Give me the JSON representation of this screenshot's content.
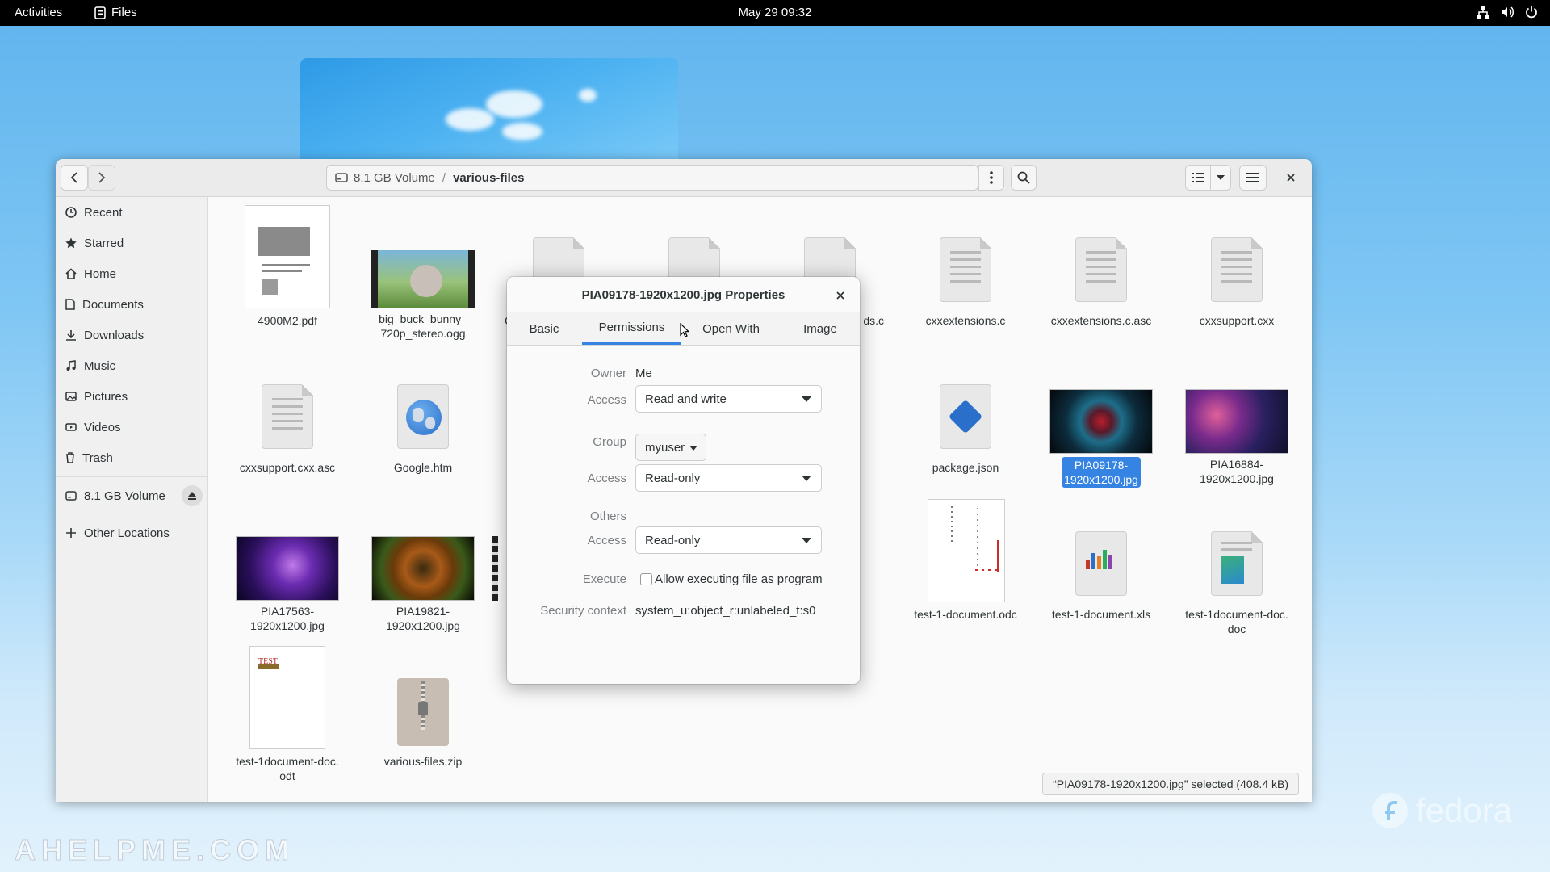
{
  "topbar": {
    "activities": "Activities",
    "app_name": "Files",
    "clock": "May 29  09:32",
    "tray_icons": [
      "network-icon",
      "volume-icon",
      "power-icon"
    ]
  },
  "files_window": {
    "pathbar": {
      "volume": "8.1 GB Volume",
      "separator": "/",
      "folder": "various-files"
    },
    "sidebar": {
      "places": [
        {
          "label": "Recent",
          "icon": "clock-icon"
        },
        {
          "label": "Starred",
          "icon": "star-icon"
        },
        {
          "label": "Home",
          "icon": "home-icon"
        },
        {
          "label": "Documents",
          "icon": "document-icon"
        },
        {
          "label": "Downloads",
          "icon": "download-icon"
        },
        {
          "label": "Music",
          "icon": "music-icon"
        },
        {
          "label": "Pictures",
          "icon": "picture-icon"
        },
        {
          "label": "Videos",
          "icon": "video-icon"
        },
        {
          "label": "Trash",
          "icon": "trash-icon"
        }
      ],
      "volume": {
        "label": "8.1 GB Volume",
        "icon": "drive-icon"
      },
      "other_locations": {
        "label": "Other Locations",
        "icon": "plus-icon"
      }
    },
    "files": [
      {
        "name": "4900M2.pdf"
      },
      {
        "name": "big_buck_bunny_\n720p_stereo.ogg"
      },
      {
        "name": "C"
      },
      {
        "name": "ds.c"
      },
      {
        "name": "cxxextensions.c"
      },
      {
        "name": "cxxextensions.c.asc"
      },
      {
        "name": "cxxsupport.cxx"
      },
      {
        "name": "cxxsupport.cxx.asc"
      },
      {
        "name": "Google.htm"
      },
      {
        "name": "package.json"
      },
      {
        "name": "PIA09178-\n1920x1200.jpg",
        "selected": true
      },
      {
        "name": "PIA16884-\n1920x1200.jpg"
      },
      {
        "name": "PIA17563-\n1920x1200.jpg"
      },
      {
        "name": "PIA19821-\n1920x1200.jpg"
      },
      {
        "name": "test-1-document.odc"
      },
      {
        "name": "test-1-document.xls"
      },
      {
        "name": "test-1document-doc.\ndoc"
      },
      {
        "name": "test-1document-doc.\nodt"
      },
      {
        "name": "various-files.zip"
      }
    ],
    "status": "“PIA09178-1920x1200.jpg” selected  (408.4 kB)"
  },
  "dialog": {
    "title": "PIA09178-1920x1200.jpg Properties",
    "tabs": [
      "Basic",
      "Permissions",
      "Open With",
      "Image"
    ],
    "active_tab": "Permissions",
    "owner_label": "Owner",
    "owner_value": "Me",
    "access_label": "Access",
    "owner_access": "Read and write",
    "group_label": "Group",
    "group_value": "myuser",
    "group_access": "Read-only",
    "others_label": "Others",
    "others_access": "Read-only",
    "execute_label": "Execute",
    "execute_checkbox": "Allow executing file as program",
    "execute_checked": false,
    "security_label": "Security context",
    "security_value": "system_u:object_r:unlabeled_t:s0"
  },
  "desktop": {
    "brand": "fedora",
    "watermark": "AHELPME.COM",
    "accent_color": "#3584e4"
  }
}
